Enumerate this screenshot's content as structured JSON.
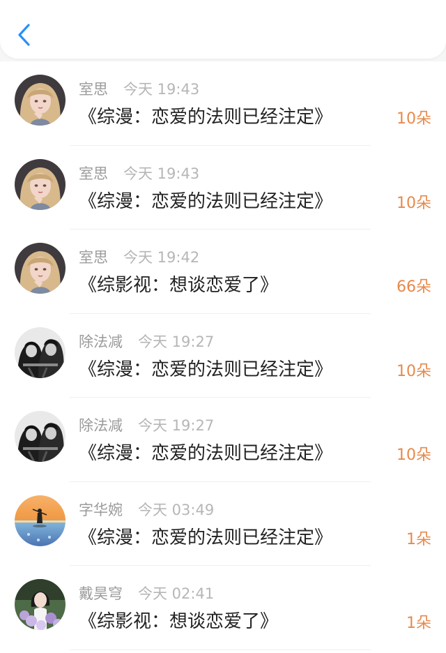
{
  "header": {
    "back_icon": "chevron-left-icon",
    "accent": "#2b8ff7"
  },
  "colors": {
    "name": "#9b9b9b",
    "time": "#b6b6b6",
    "title": "#222222",
    "amount": "#e8894a"
  },
  "records": [
    {
      "name": "室思",
      "time": "今天 19:43",
      "title": "《综漫：恋爱的法则已经注定》",
      "amount": "10朵",
      "avatar": "anime-girl-blonde-avatar"
    },
    {
      "name": "室思",
      "time": "今天 19:43",
      "title": "《综漫：恋爱的法则已经注定》",
      "amount": "10朵",
      "avatar": "anime-girl-blonde-avatar"
    },
    {
      "name": "室思",
      "time": "今天 19:42",
      "title": "《综影视：想谈恋爱了》",
      "amount": "66朵",
      "avatar": "anime-girl-blonde-avatar"
    },
    {
      "name": "除法减",
      "time": "今天 19:27",
      "title": "《综漫：恋爱的法则已经注定》",
      "amount": "10朵",
      "avatar": "monochrome-anime-pair-avatar"
    },
    {
      "name": "除法减",
      "time": "今天 19:27",
      "title": "《综漫：恋爱的法则已经注定》",
      "amount": "10朵",
      "avatar": "monochrome-anime-pair-avatar"
    },
    {
      "name": "字华婉",
      "time": "今天 03:49",
      "title": "《综漫：恋爱的法则已经注定》",
      "amount": "1朵",
      "avatar": "sunset-silhouette-avatar"
    },
    {
      "name": "戴昊穹",
      "time": "今天 02:41",
      "title": "《综影视：想谈恋爱了》",
      "amount": "1朵",
      "avatar": "woman-with-flowers-avatar"
    }
  ]
}
